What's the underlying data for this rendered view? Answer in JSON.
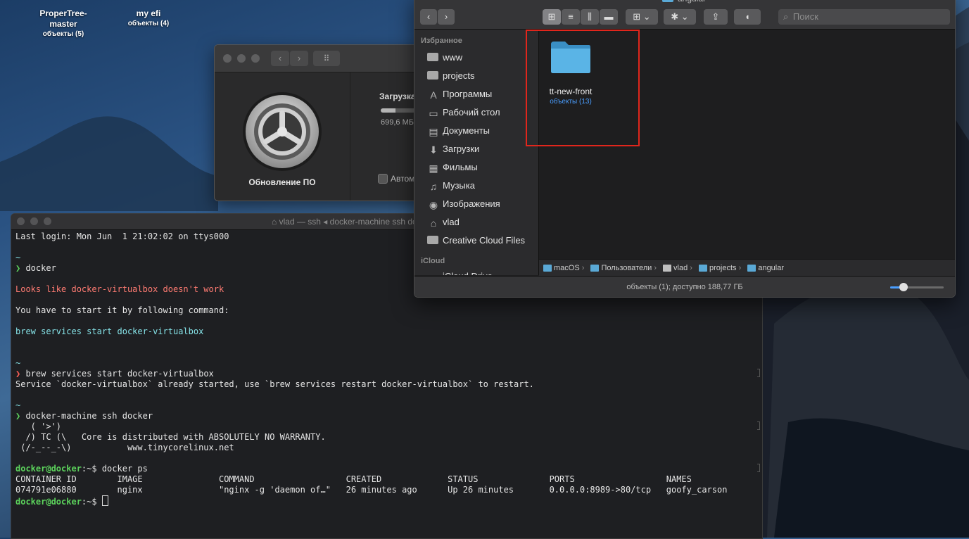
{
  "desktop": {
    "icons": [
      {
        "title": "ProperTree-\nmaster",
        "sub": "объекты (5)"
      },
      {
        "title": "my efi",
        "sub": "объекты (4)"
      }
    ]
  },
  "software_update": {
    "label": "Обновление ПО",
    "downloading": "Загрузка",
    "size": "699,6 МБ",
    "auto_label": "Автом",
    "progress": 0.35
  },
  "terminal": {
    "title": "vlad — ssh ◂ docker-machine ssh docker",
    "lines": [
      {
        "segs": [
          {
            "t": "Last login: Mon Jun  1 21:02:02 on ttys000",
            "c": ""
          }
        ]
      },
      {
        "segs": [
          {
            "t": "",
            "c": ""
          }
        ]
      },
      {
        "segs": [
          {
            "t": "~",
            "c": "cyan"
          }
        ]
      },
      {
        "segs": [
          {
            "t": "❯",
            "c": "prompt-ok"
          },
          {
            "t": " docker",
            "c": ""
          }
        ]
      },
      {
        "segs": [
          {
            "t": "",
            "c": ""
          }
        ]
      },
      {
        "segs": [
          {
            "t": "Looks like docker-virtualbox doesn't work",
            "c": "red"
          }
        ]
      },
      {
        "segs": [
          {
            "t": "",
            "c": ""
          }
        ]
      },
      {
        "segs": [
          {
            "t": "You have to start it by following command:",
            "c": ""
          }
        ]
      },
      {
        "segs": [
          {
            "t": "",
            "c": ""
          }
        ]
      },
      {
        "segs": [
          {
            "t": "brew services start docker-virtualbox",
            "c": "cyan"
          }
        ]
      },
      {
        "segs": [
          {
            "t": "",
            "c": ""
          }
        ]
      },
      {
        "segs": [
          {
            "t": "",
            "c": ""
          }
        ]
      },
      {
        "segs": [
          {
            "t": "~",
            "c": "cyan"
          }
        ]
      },
      {
        "segs": [
          {
            "t": "❯",
            "c": "prompt-err"
          },
          {
            "t": " brew services start docker-virtualbox",
            "c": ""
          }
        ]
      },
      {
        "segs": [
          {
            "t": "Service `docker-virtualbox` already started, use `brew services restart docker-virtualbox` to restart.",
            "c": ""
          }
        ]
      },
      {
        "segs": [
          {
            "t": "",
            "c": ""
          }
        ]
      },
      {
        "segs": [
          {
            "t": "~",
            "c": "cyan"
          }
        ]
      },
      {
        "segs": [
          {
            "t": "❯",
            "c": "prompt-ok"
          },
          {
            "t": " docker-machine ssh docker",
            "c": ""
          }
        ]
      },
      {
        "segs": [
          {
            "t": "   ( '>')",
            "c": ""
          }
        ]
      },
      {
        "segs": [
          {
            "t": "  /) TC (\\   Core is distributed with ABSOLUTELY NO WARRANTY.",
            "c": ""
          }
        ]
      },
      {
        "segs": [
          {
            "t": " (/-_--_-\\)           www.tinycorelinux.net",
            "c": ""
          }
        ]
      },
      {
        "segs": [
          {
            "t": "",
            "c": ""
          }
        ]
      },
      {
        "segs": [
          {
            "t": "docker@docker",
            "c": "uh"
          },
          {
            "t": ":~$ docker ps",
            "c": ""
          }
        ]
      },
      {
        "segs": [
          {
            "t": "CONTAINER ID        IMAGE               COMMAND                  CREATED             STATUS              PORTS                  NAMES",
            "c": ""
          }
        ]
      },
      {
        "segs": [
          {
            "t": "074791e06880        nginx               \"nginx -g 'daemon of…\"   26 minutes ago      Up 26 minutes       0.0.0.0:8989->80/tcp   goofy_carson",
            "c": ""
          }
        ]
      },
      {
        "segs": [
          {
            "t": "docker@docker",
            "c": "uh"
          },
          {
            "t": ":~$ ",
            "c": ""
          }
        ],
        "cursor": true
      }
    ]
  },
  "finder": {
    "title": "angular",
    "search_placeholder": "Поиск",
    "favorites_header": "Избранное",
    "favorites": [
      {
        "label": "www",
        "icon": "folder-icon"
      },
      {
        "label": "projects",
        "icon": "folder-icon"
      },
      {
        "label": "Программы",
        "icon": "applications-icon",
        "glyph": "A"
      },
      {
        "label": "Рабочий стол",
        "icon": "desktop-icon",
        "glyph": "▭"
      },
      {
        "label": "Документы",
        "icon": "document-icon",
        "glyph": "▤"
      },
      {
        "label": "Загрузки",
        "icon": "download-icon",
        "glyph": "⬇"
      },
      {
        "label": "Фильмы",
        "icon": "movies-icon",
        "glyph": "▦"
      },
      {
        "label": "Музыка",
        "icon": "music-icon",
        "glyph": "♫"
      },
      {
        "label": "Изображения",
        "icon": "camera-icon",
        "glyph": "◉"
      },
      {
        "label": "vlad",
        "icon": "home-icon",
        "glyph": "⌂"
      },
      {
        "label": "Creative Cloud Files",
        "icon": "folder-icon"
      }
    ],
    "icloud_header": "iCloud",
    "icloud": [
      {
        "label": "iCloud Drive",
        "icon": "cloud-icon",
        "glyph": "☁"
      }
    ],
    "item": {
      "name": "tt-new-front",
      "sub": "объекты (13)"
    },
    "path": [
      {
        "label": "macOS",
        "icon": "disk-icon"
      },
      {
        "label": "Пользователи",
        "icon": "folder-icon"
      },
      {
        "label": "vlad",
        "icon": "home-icon"
      },
      {
        "label": "projects",
        "icon": "folder-icon"
      },
      {
        "label": "angular",
        "icon": "folder-icon"
      }
    ],
    "status": "объекты (1); доступно 188,77 ГБ",
    "zoom": 0.25
  }
}
